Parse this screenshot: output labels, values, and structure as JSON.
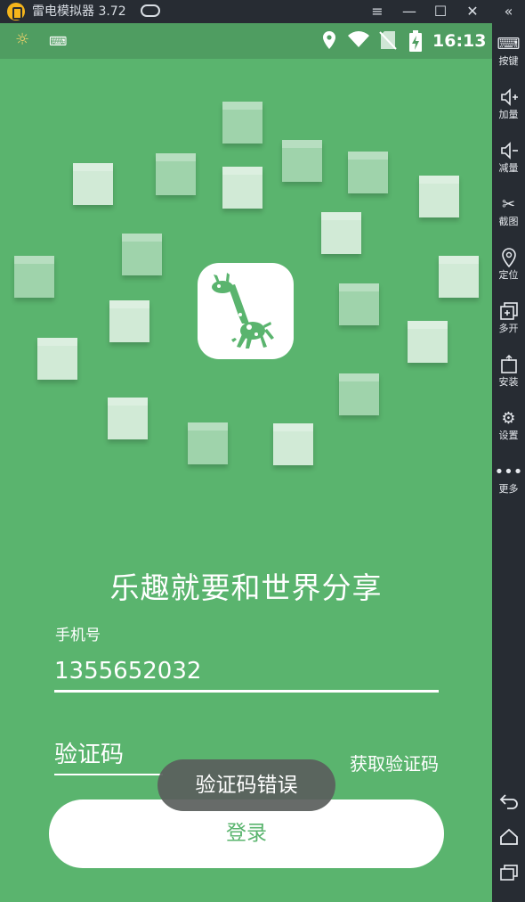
{
  "emulator": {
    "title": "雷电模拟器 3.72",
    "window_controls": [
      "≡",
      "—",
      "☐",
      "✕",
      "«"
    ],
    "toolbar": [
      {
        "icon": "keyboard-icon",
        "label": "按键"
      },
      {
        "icon": "volume-up-icon",
        "label": "加量"
      },
      {
        "icon": "volume-down-icon",
        "label": "减量"
      },
      {
        "icon": "scissors-icon",
        "label": "截图"
      },
      {
        "icon": "location-pin-icon",
        "label": "定位"
      },
      {
        "icon": "multi-window-icon",
        "label": "多开"
      },
      {
        "icon": "apk-install-icon",
        "label": "安装"
      },
      {
        "icon": "gear-icon",
        "label": "设置"
      },
      {
        "icon": "more-dots-icon",
        "label": "更多"
      }
    ],
    "nav": [
      "back-icon",
      "home-icon",
      "recent-apps-icon"
    ]
  },
  "status_bar": {
    "time": "16:13"
  },
  "app": {
    "headline": "乐趣就要和世界分享",
    "phone_label": "手机号",
    "phone_value": "1355652032",
    "code_placeholder": "验证码",
    "get_code": "获取验证码",
    "login": "登录",
    "toast": "验证码错误",
    "accent_color": "#5ab46e"
  }
}
